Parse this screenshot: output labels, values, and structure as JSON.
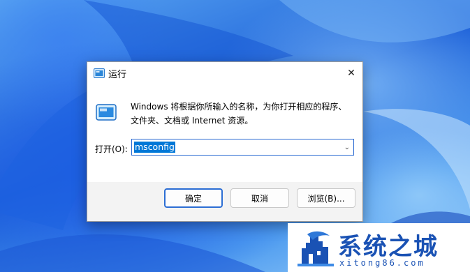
{
  "dialog": {
    "title": "运行",
    "close_glyph": "✕",
    "description_line1": "Windows 将根据你所输入的名称，为你打开相应的程序、",
    "description_line2": "文件夹、文档或 Internet 资源。",
    "open_label": "打开(O):",
    "open_value": "msconfig",
    "dropdown_glyph": "⌄",
    "buttons": {
      "ok": "确定",
      "cancel": "取消",
      "browse": "浏览(B)..."
    }
  },
  "watermark": {
    "title": "系统之城",
    "subtitle": "xitong86.com"
  },
  "icons": {
    "dialog_title_icon": "run-icon",
    "dialog_body_icon": "run-icon",
    "close": "close-icon",
    "dropdown": "chevron-down-icon",
    "watermark_logo": "castle-icon"
  },
  "colors": {
    "accent": "#0078d7",
    "focus_border": "#2c6ed4",
    "watermark_blue": "#1a52b4"
  }
}
